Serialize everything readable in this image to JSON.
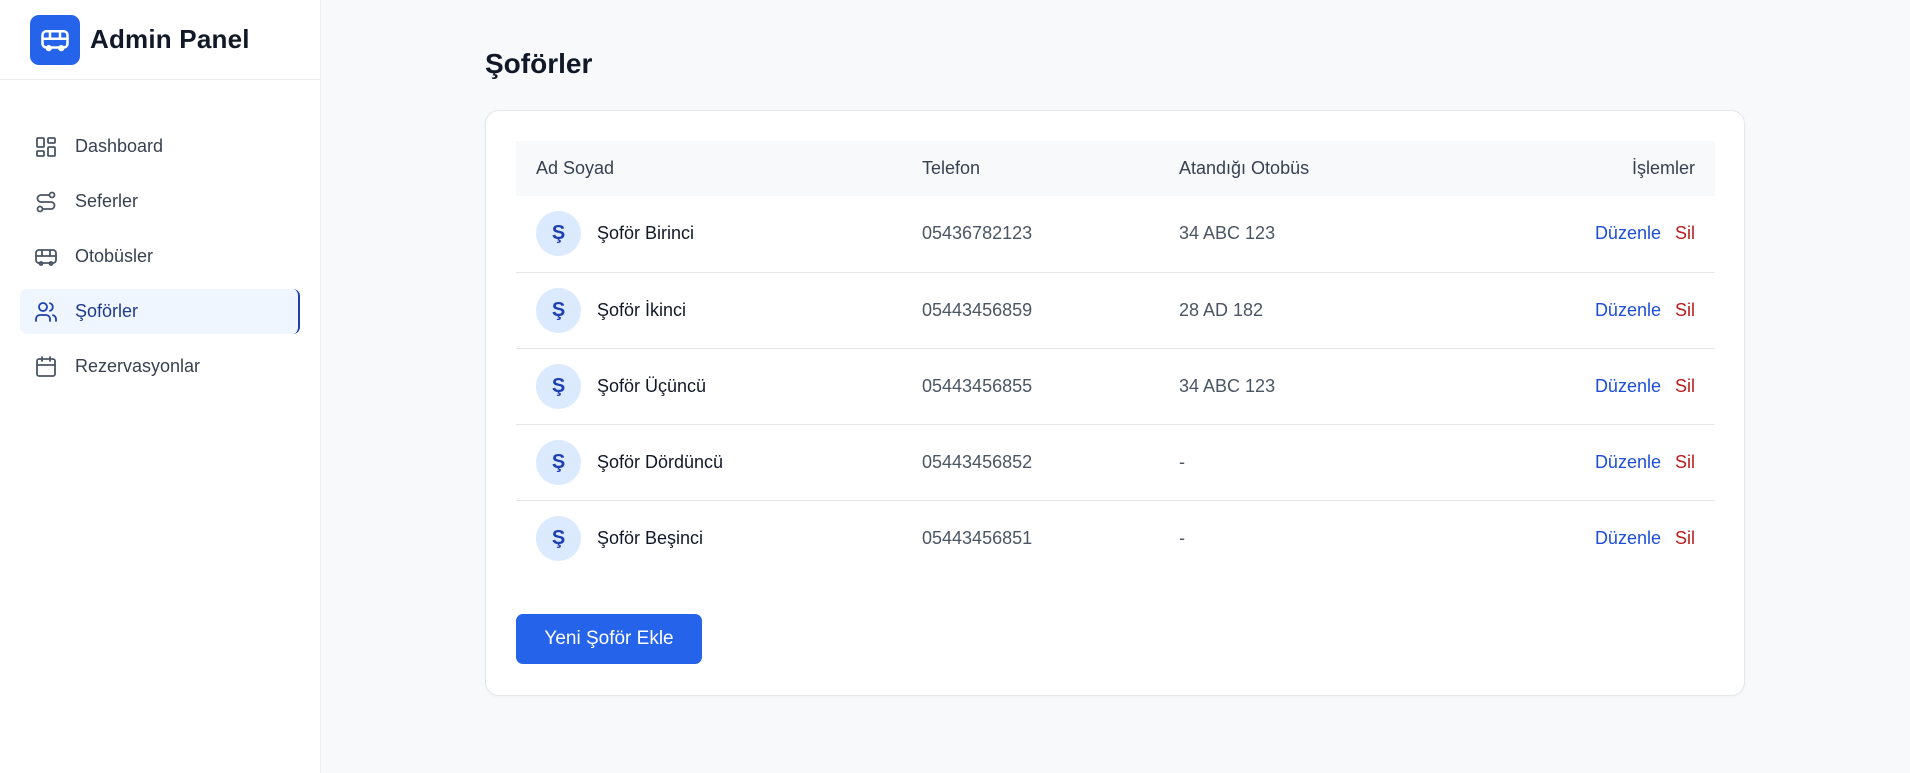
{
  "brand": {
    "title": "Admin Panel",
    "icon": "bus-icon",
    "color": "#2563eb"
  },
  "sidebar": {
    "items": [
      {
        "label": "Dashboard",
        "icon": "dashboard-icon",
        "active": false
      },
      {
        "label": "Seferler",
        "icon": "route-icon",
        "active": false
      },
      {
        "label": "Otobüsler",
        "icon": "bus-icon",
        "active": false
      },
      {
        "label": "Şoförler",
        "icon": "users-icon",
        "active": true
      },
      {
        "label": "Rezervasyonlar",
        "icon": "calendar-icon",
        "active": false
      }
    ]
  },
  "page": {
    "title": "Şoförler"
  },
  "table": {
    "headers": {
      "name": "Ad Soyad",
      "phone": "Telefon",
      "bus": "Atandığı Otobüs",
      "actions": "İşlemler"
    },
    "rows": [
      {
        "initial": "Ş",
        "name": "Şoför Birinci",
        "phone": "05436782123",
        "bus": "34 ABC 123",
        "edit": "Düzenle",
        "delete": "Sil"
      },
      {
        "initial": "Ş",
        "name": "Şoför İkinci",
        "phone": "05443456859",
        "bus": "28 AD 182",
        "edit": "Düzenle",
        "delete": "Sil"
      },
      {
        "initial": "Ş",
        "name": "Şoför Üçüncü",
        "phone": "05443456855",
        "bus": "34 ABC 123",
        "edit": "Düzenle",
        "delete": "Sil"
      },
      {
        "initial": "Ş",
        "name": "Şoför Dördüncü",
        "phone": "05443456852",
        "bus": "-",
        "edit": "Düzenle",
        "delete": "Sil"
      },
      {
        "initial": "Ş",
        "name": "Şoför Beşinci",
        "phone": "05443456851",
        "bus": "-",
        "edit": "Düzenle",
        "delete": "Sil"
      }
    ]
  },
  "actions": {
    "add_label": "Yeni Şoför Ekle"
  },
  "colors": {
    "accent": "#2563eb",
    "edit": "#1d4ed8",
    "delete": "#b91c1c"
  }
}
